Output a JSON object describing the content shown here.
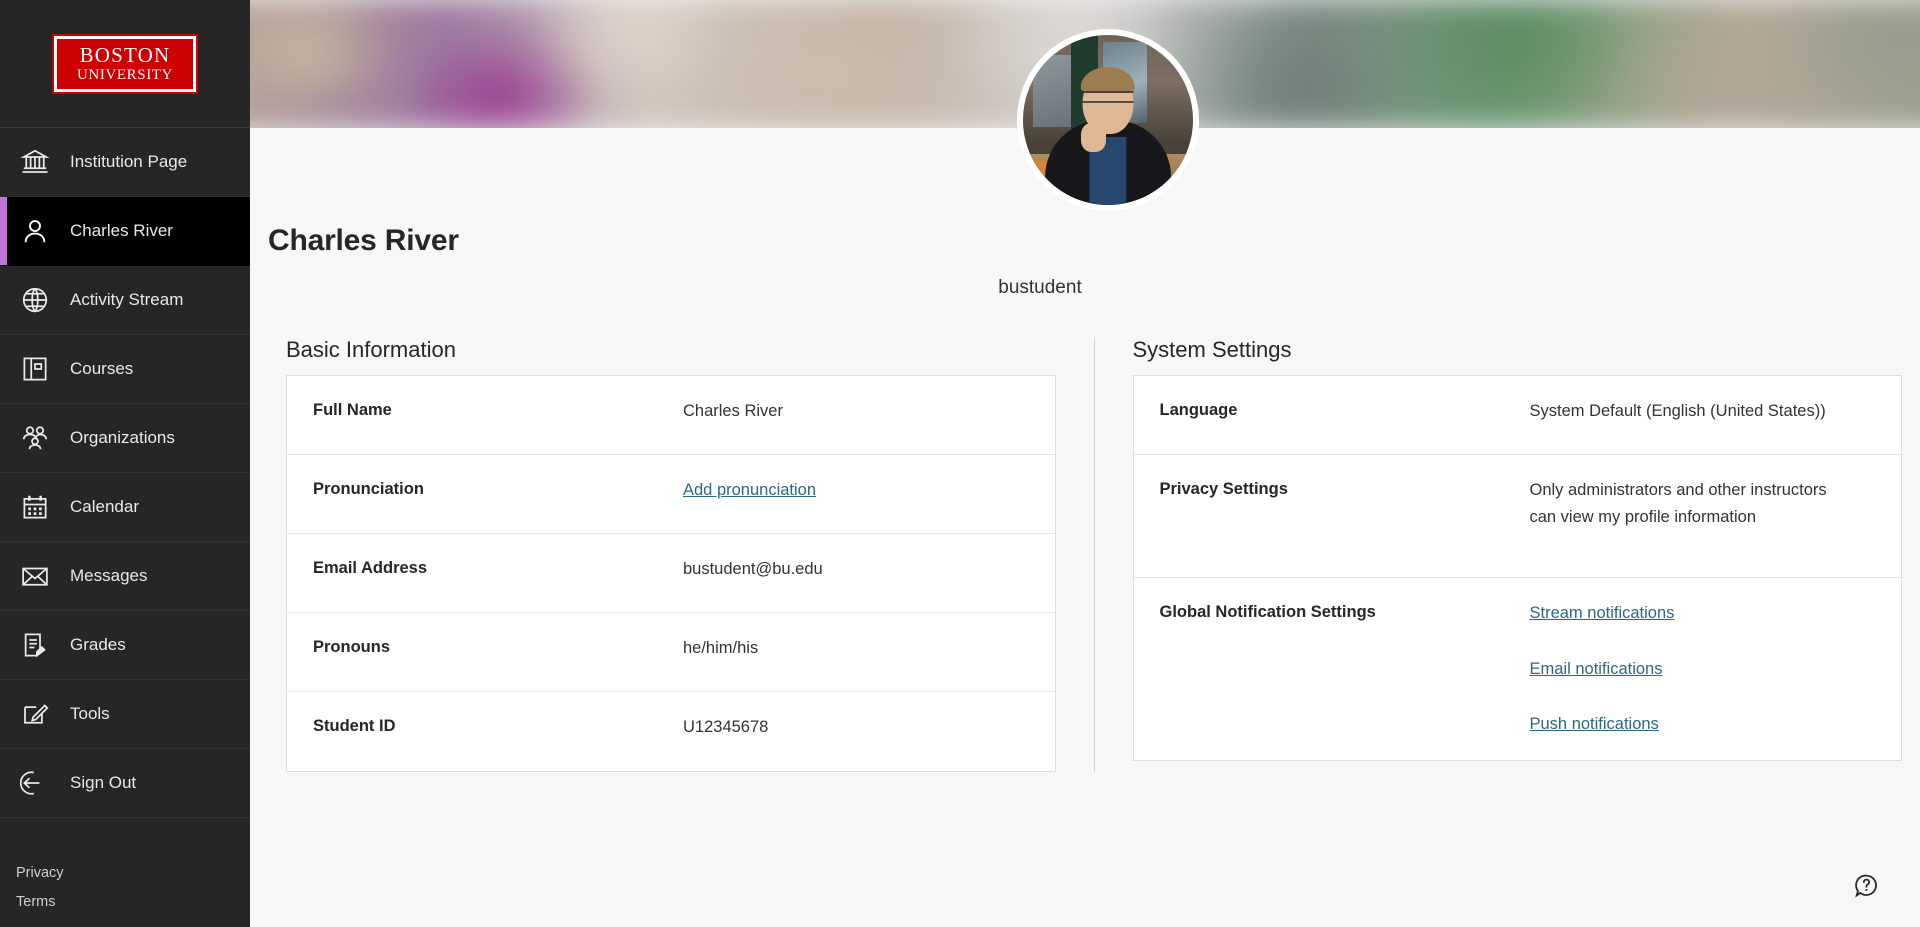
{
  "brand": {
    "logo_line1": "BOSTON",
    "logo_line2": "UNIVERSITY",
    "logo_bg": "#cc0000",
    "accent": "#c073d8",
    "link_color": "#2a6980"
  },
  "sidebar": {
    "items": [
      {
        "label": "Institution Page",
        "icon": "institution-icon",
        "active": false
      },
      {
        "label": "Charles River",
        "icon": "person-icon",
        "active": true
      },
      {
        "label": "Activity Stream",
        "icon": "globe-icon",
        "active": false
      },
      {
        "label": "Courses",
        "icon": "book-icon",
        "active": false
      },
      {
        "label": "Organizations",
        "icon": "people-icon",
        "active": false
      },
      {
        "label": "Calendar",
        "icon": "calendar-icon",
        "active": false
      },
      {
        "label": "Messages",
        "icon": "envelope-icon",
        "active": false
      },
      {
        "label": "Grades",
        "icon": "grades-icon",
        "active": false
      },
      {
        "label": "Tools",
        "icon": "tools-pencil-icon",
        "active": false
      },
      {
        "label": "Sign Out",
        "icon": "sign-out-icon",
        "active": false
      }
    ],
    "footer_links": [
      "Privacy",
      "Terms"
    ]
  },
  "profile": {
    "name": "Charles River",
    "username": "bustudent",
    "avatar": "profile-photo"
  },
  "basic_information": {
    "heading": "Basic Information",
    "rows": [
      {
        "label": "Full Name",
        "value": "Charles River",
        "is_link": false
      },
      {
        "label": "Pronunciation",
        "value": "Add pronunciation",
        "is_link": true
      },
      {
        "label": "Email Address",
        "value": "bustudent@bu.edu",
        "is_link": false
      },
      {
        "label": "Pronouns",
        "value": "he/him/his",
        "is_link": false
      },
      {
        "label": "Student ID",
        "value": "U12345678",
        "is_link": false
      }
    ]
  },
  "system_settings": {
    "heading": "System Settings",
    "rows": [
      {
        "label": "Language",
        "value": "System Default (English (United States))"
      },
      {
        "label": "Privacy Settings",
        "value": "Only administrators and other instructors can view my profile information"
      },
      {
        "label": "Global Notification Settings",
        "links": [
          "Stream notifications",
          "Email notifications",
          "Push notifications"
        ]
      }
    ]
  },
  "help": {
    "icon": "help-question-icon",
    "label": "Help"
  }
}
